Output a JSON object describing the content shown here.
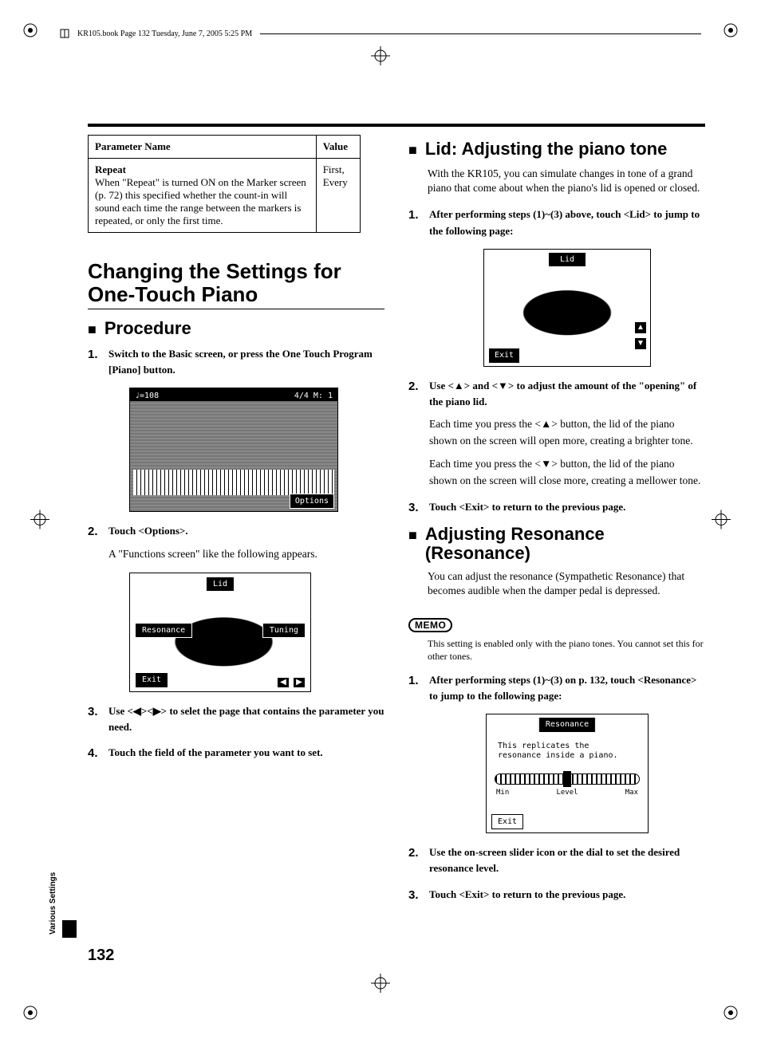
{
  "header_line": "KR105.book  Page 132  Tuesday, June 7, 2005  5:25 PM",
  "side_tab": "Various Settings",
  "page_number": "132",
  "table": {
    "head_param": "Parameter Name",
    "head_value": "Value",
    "row_name": "Repeat",
    "row_desc": "When \"Repeat\" is turned ON on the Marker screen (p. 72) this specified whether the count-in will sound each time the range between the markers is repeated, or only the first time.",
    "row_value": "First, Every"
  },
  "left": {
    "h1": "Changing the Settings for One-Touch Piano",
    "h2_procedure": "Procedure",
    "step1": "Switch to the Basic screen, or press the One Touch Program [Piano] button.",
    "ss1_bar_left": "♩=108",
    "ss1_bar_right": "4/4  M:   1",
    "ss1_options": "Options",
    "step2_main": "Touch <Options>.",
    "step2_body": "A \"Functions screen\" like the following appears.",
    "ss2_lid": "Lid",
    "ss2_res": "Resonance",
    "ss2_tun": "Tuning",
    "ss2_exit": "Exit",
    "step3": "Use <◀><▶> to selet the page that contains the parameter you need.",
    "step4": "Touch the field of the parameter you want to set."
  },
  "right": {
    "h2_lid": "Lid: Adjusting the piano tone",
    "lid_intro": "With the KR105, you can simulate changes in tone of a grand piano that come about when the piano's lid is opened or closed.",
    "lid_step1": "After performing steps (1)~(3) above, touch <Lid> to jump to the following page:",
    "ss3_title": "Lid",
    "ss3_exit": "Exit",
    "lid_step2_main": "Use <▲> and <▼> to adjust the amount of the \"opening\" of the piano lid.",
    "lid_step2_body1": "Each time you press the <▲> button, the lid of the piano shown on the screen will open more, creating a brighter tone.",
    "lid_step2_body2": "Each time you press the <▼> button, the lid of the piano shown on the screen will close more, creating a mellower tone.",
    "lid_step3": "Touch <Exit> to return to the previous page.",
    "h2_res": "Adjusting Resonance (Resonance)",
    "res_intro": "You can adjust the resonance (Sympathetic Resonance) that becomes audible when the damper pedal is depressed.",
    "memo_label": "MEMO",
    "memo_text": "This setting is enabled only with the piano tones. You cannot set this for other tones.",
    "res_step1": "After performing steps (1)~(3) on p. 132, touch <Resonance> to jump to the following page:",
    "ss4_title": "Resonance",
    "ss4_txt": "This replicates the resonance inside a piano.",
    "ss4_min": "Min",
    "ss4_level": "Level",
    "ss4_max": "Max",
    "ss4_exit": "Exit",
    "res_step2": "Use the on-screen slider icon or the dial to set the desired resonance level.",
    "res_step3": "Touch <Exit> to return to the previous page."
  }
}
